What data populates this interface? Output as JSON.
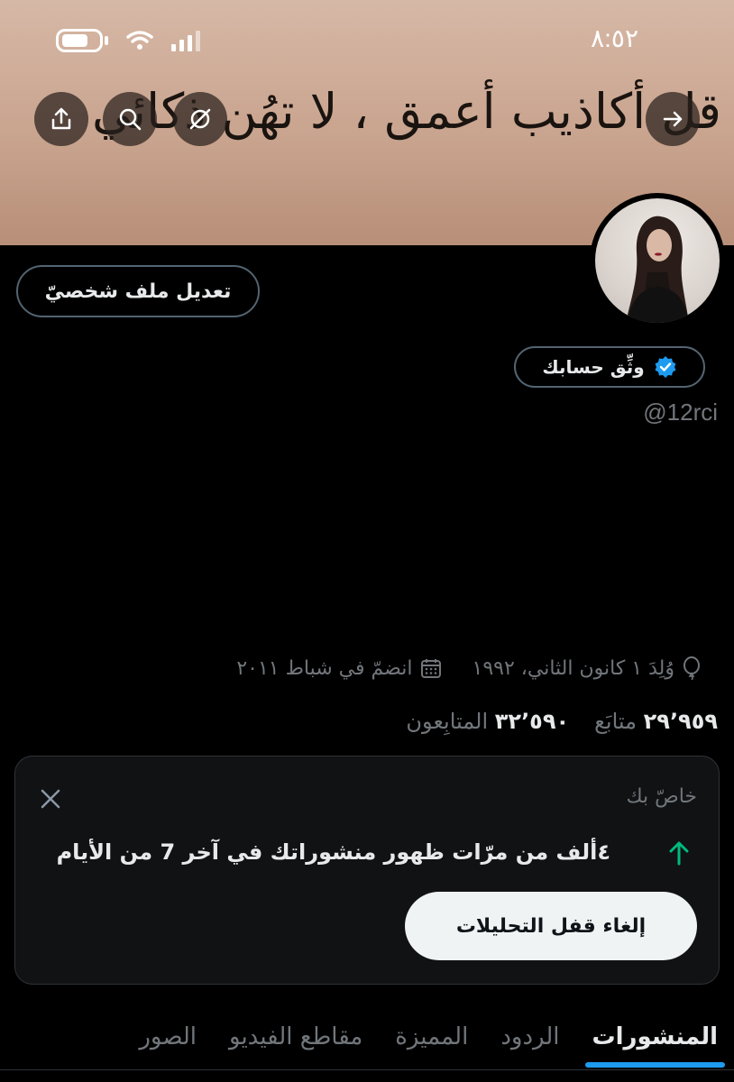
{
  "status_bar": {
    "time": "٨:٥٢"
  },
  "banner": {
    "text": "قل أكاذيب أعمق ، لا تهُن ذكائي"
  },
  "header_actions": [
    "forward-arrow",
    "hide",
    "search",
    "share"
  ],
  "profile": {
    "edit_label": "تعديل ملف شخصيّ",
    "verify_label": "وثِّق حسابك",
    "handle": "@12rci",
    "birth": "وُلِدَ ١ كانون الثاني، ١٩٩٢",
    "joined": "انضمّ في شباط ٢٠١١",
    "following_count": "٢٩٬٩٥٩",
    "following_label": "متابَع",
    "followers_count": "٣٢٬٥٩٠",
    "followers_label": "المتابِعون"
  },
  "insight_card": {
    "title": "خاصّ بك",
    "message": "٤ألف من مرّات ظهور منشوراتك في آخر 7 من الأيام",
    "button_label": "إلغاء قفل التحليلات"
  },
  "tabs": [
    "المنشورات",
    "الردود",
    "المميزة",
    "مقاطع الفيديو",
    "الصور"
  ],
  "colors": {
    "accent": "#1d9bf0",
    "trend_up": "#00ba7c",
    "muted": "#71767b"
  }
}
